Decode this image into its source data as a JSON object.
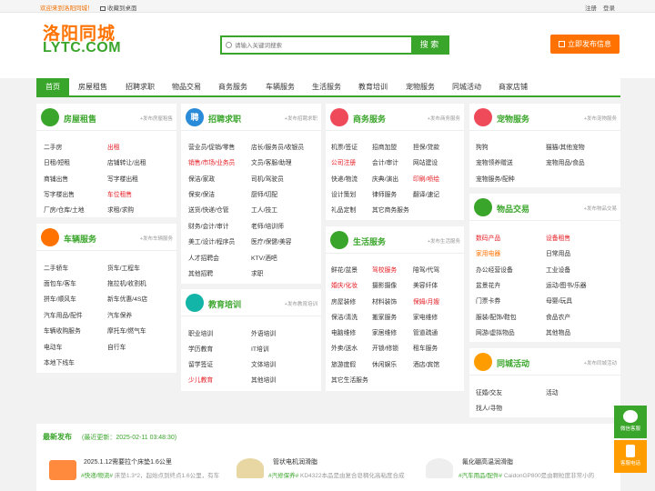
{
  "topbar": {
    "welcome": "欢迎来到洛阳同城！",
    "fav": "收藏到桌面",
    "register": "注册",
    "login": "登录"
  },
  "logo": {
    "cn": "洛阳同城",
    "en": "LYTC.COM"
  },
  "search": {
    "placeholder": "请输入关键词搜索",
    "button": "搜 索"
  },
  "publish": "立即发布信息",
  "nav": [
    "首页",
    "房屋租售",
    "招聘求职",
    "物品交易",
    "商务服务",
    "车辆服务",
    "生活服务",
    "教育培训",
    "宠物服务",
    "同城活动",
    "商家店铺"
  ],
  "cards": {
    "house": {
      "title": "房屋租售",
      "pub": "+发布房屋租售",
      "color": "#3aa52b",
      "cells": [
        "二手房",
        "出租",
        "日租/短租",
        "店铺转让/出租",
        "商铺出售",
        "写字楼出租",
        "写字楼出售",
        "车位租售",
        "厂房/仓库/土地",
        "求租/求购"
      ]
    },
    "job": {
      "title": "招聘求职",
      "pub": "+发布招聘求职",
      "color": "#2a8bd8",
      "icon_text": "聘",
      "cells": [
        "营业员/促销/零售",
        "店长/服务员/收银员",
        "销售/市场/业务员",
        "文员/客服/助理",
        "保洁/家政",
        "司机/驾驶员",
        "保安/保洁",
        "厨师/切配",
        "送货/快递/仓管",
        "工人/技工",
        "财务/会计/审计",
        "老师/培训师",
        "美工/设计/程序员",
        "医疗/保健/美容",
        "人才招聘会",
        "KTV/酒吧",
        "其他招聘",
        "求职"
      ]
    },
    "biz": {
      "title": "商务服务",
      "pub": "+发布商务服务",
      "color": "#ef4a5a",
      "cells": [
        "机票/签证",
        "招商加盟",
        "担保/贷款",
        "公司注册",
        "会计/审计",
        "网站建设",
        "快递/物流",
        "庆典/演出",
        "印刷/喷绘",
        "设计策划",
        "律师服务",
        "翻译/速记",
        "礼品定制",
        "其它商务服务"
      ]
    },
    "pet": {
      "title": "宠物服务",
      "pub": "+发布宠物服务",
      "color": "#ef4a5a",
      "cells": [
        "狗狗",
        "猫猫/其他宠物",
        "宠物领养赠送",
        "宠物用品/食品",
        "宠物服务/配种"
      ]
    },
    "car": {
      "title": "车辆服务",
      "pub": "+发布车辆服务",
      "color": "#ff7200",
      "cells": [
        "二手轿车",
        "货车/工程车",
        "面包车/客车",
        "拖拉机/收割机",
        "拼车/顺风车",
        "新车优惠/4S店",
        "汽车用品/配件",
        "汽车保养",
        "车辆收购服务",
        "摩托车/燃气车",
        "电动车",
        "自行车",
        "本地下线车"
      ]
    },
    "edu": {
      "title": "教育培训",
      "pub": "+发布教育培训",
      "color": "#13b5a8",
      "cells": [
        "职业培训",
        "外语培训",
        "学历教育",
        "IT培训",
        "留学签证",
        "文体培训",
        "少儿教育",
        "其他培训"
      ]
    },
    "life": {
      "title": "生活服务",
      "pub": "+发布生活服务",
      "color": "#3aa52b",
      "cells": [
        "鲜花/盆景",
        "驾校服务",
        "陪驾/代驾",
        "婚庆/化妆",
        "摄影摄像",
        "美容纤体",
        "房屋装修",
        "材料装饰",
        "保姆/月嫂",
        "保洁/清洗",
        "搬家服务",
        "家电维修",
        "电脑维修",
        "家居维修",
        "管道疏通",
        "外卖/送水",
        "开锁/修锁",
        "租车服务",
        "旅游度假",
        "休闲娱乐",
        "酒店/宾馆",
        "其它生活服务"
      ]
    },
    "goods": {
      "title": "物品交易",
      "pub": "+发布物品交易",
      "color": "#3aa52b",
      "cells": [
        "数码产品",
        "设备租售",
        "家用电器",
        "日常用品",
        "办公经营设备",
        "工业设备",
        "盆景花卉",
        "运动/图书/乐器",
        "门票卡券",
        "母婴/玩具",
        "服装/配饰/鞋包",
        "食品农产",
        "网游/虚拟物品",
        "其他物品"
      ]
    },
    "event": {
      "title": "同城活动",
      "pub": "+发布同城活动",
      "color": "#ff9d00",
      "cells": [
        "征婚/交友",
        "活动",
        "找人/寻物"
      ]
    }
  },
  "latest": {
    "title": "最新发布",
    "updated": "(最近更新：2025-02-11 03:48:30)",
    "items": [
      {
        "title": "2025.1.12需要拉个床垫1.6公里",
        "tag": "#快递/物流#",
        "desc": " 床垫1.3*2，起始点到终点1.6公里，有车"
      },
      {
        "title": "管状电机润滑脂",
        "tag": "#汽修保养#",
        "desc": " KD4322本品是由复合皂稠化高粘度合成"
      },
      {
        "title": "氟化硼高温润滑脂",
        "tag": "#汽车用品/配件#",
        "desc": " CaidonGP800是由颗粒度非常小的"
      }
    ]
  },
  "side": {
    "wechat": "微信客服",
    "phone": "客服电话"
  }
}
